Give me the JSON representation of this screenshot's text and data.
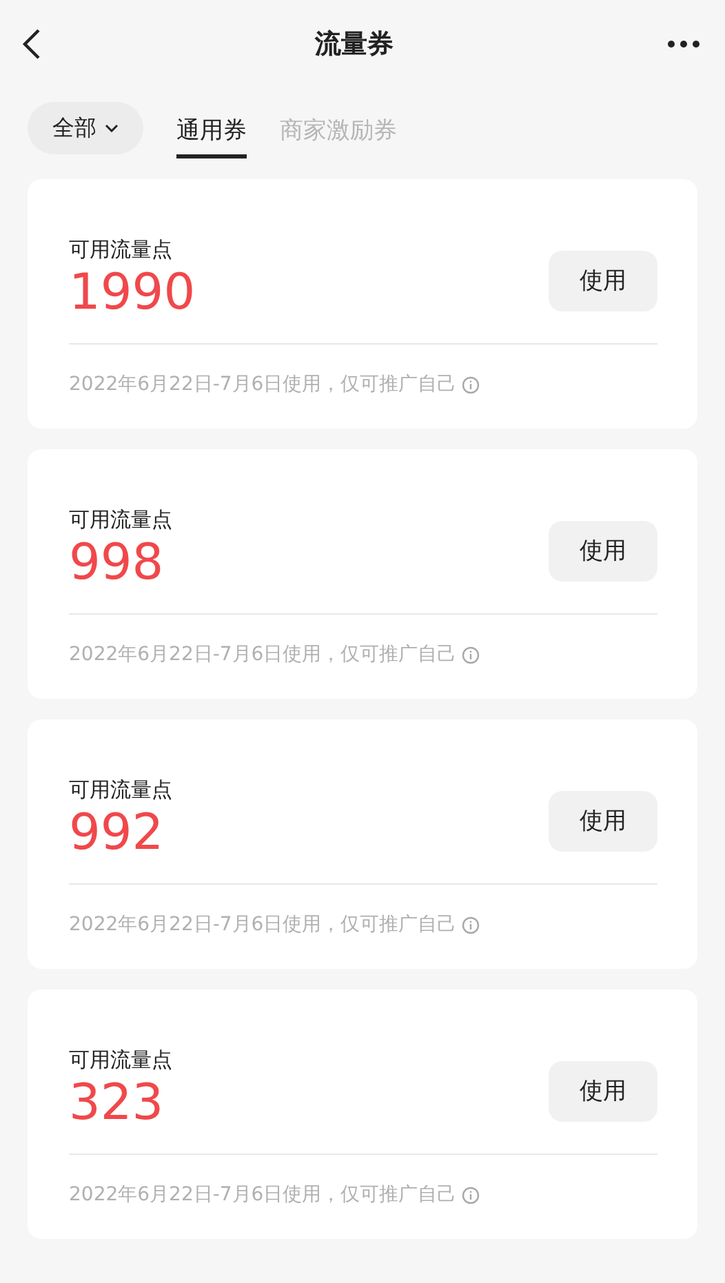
{
  "header": {
    "title": "流量券"
  },
  "filter": {
    "label": "全部"
  },
  "tabs": [
    {
      "label": "通用券",
      "selected": true
    },
    {
      "label": "商家激励券",
      "selected": false
    }
  ],
  "coupons": [
    {
      "label": "可用流量点",
      "amount": "1990",
      "button": "使用",
      "note": "2022年6月22日-7月6日使用，仅可推广自己"
    },
    {
      "label": "可用流量点",
      "amount": "998",
      "button": "使用",
      "note": "2022年6月22日-7月6日使用，仅可推广自己"
    },
    {
      "label": "可用流量点",
      "amount": "992",
      "button": "使用",
      "note": "2022年6月22日-7月6日使用，仅可推广自己"
    },
    {
      "label": "可用流量点",
      "amount": "323",
      "button": "使用",
      "note": "2022年6月22日-7月6日使用，仅可推广自己"
    }
  ]
}
